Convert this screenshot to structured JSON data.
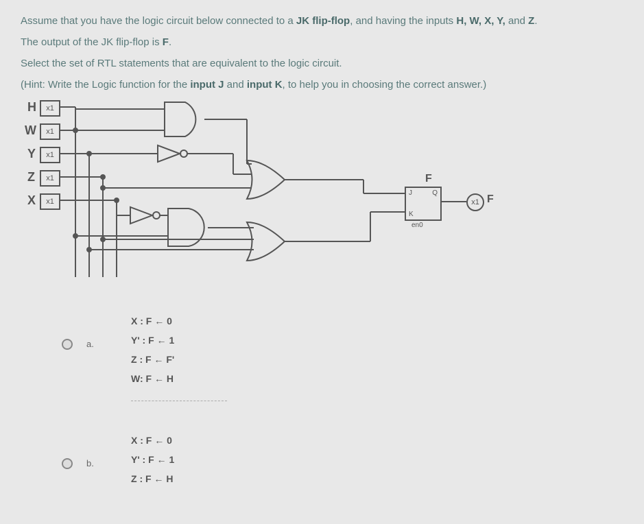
{
  "intro": {
    "line1_a": "Assume that you have the logic circuit below connected to a ",
    "line1_bold": "JK flip-flop",
    "line1_b": ", and having the inputs ",
    "line1_inputs": "H, W, X, Y, ",
    "line1_c": "and ",
    "line1_z": "Z",
    "line2_a": "The output of the JK flip-flop is ",
    "line2_bold": "F",
    "line2_b": ".",
    "line3": "Select the set of RTL statements that are equivalent to the logic circuit.",
    "line4_a": "(Hint: Write the Logic function for the ",
    "line4_b1": "input J",
    "line4_b": " and ",
    "line4_b2": "input K",
    "line4_c": ", to help you in choosing the correct answer.)"
  },
  "inputs": {
    "H": "H",
    "W": "W",
    "Y": "Y",
    "Z": "Z",
    "X": "X",
    "x1": "x1"
  },
  "ff": {
    "J": "J",
    "K": "K",
    "Q": "Q",
    "en": "en0",
    "F_label": "F"
  },
  "circuit_output": {
    "F": "F",
    "x1": "x1"
  },
  "options": {
    "a": {
      "letter": "a.",
      "lines": [
        "X : F ← 0",
        "Y' : F ← 1",
        "Z : F ← F'",
        "W: F ← H"
      ]
    },
    "b": {
      "letter": "b.",
      "lines": [
        "X : F ← 0",
        "Y' : F ← 1",
        "Z : F ← H"
      ]
    }
  }
}
